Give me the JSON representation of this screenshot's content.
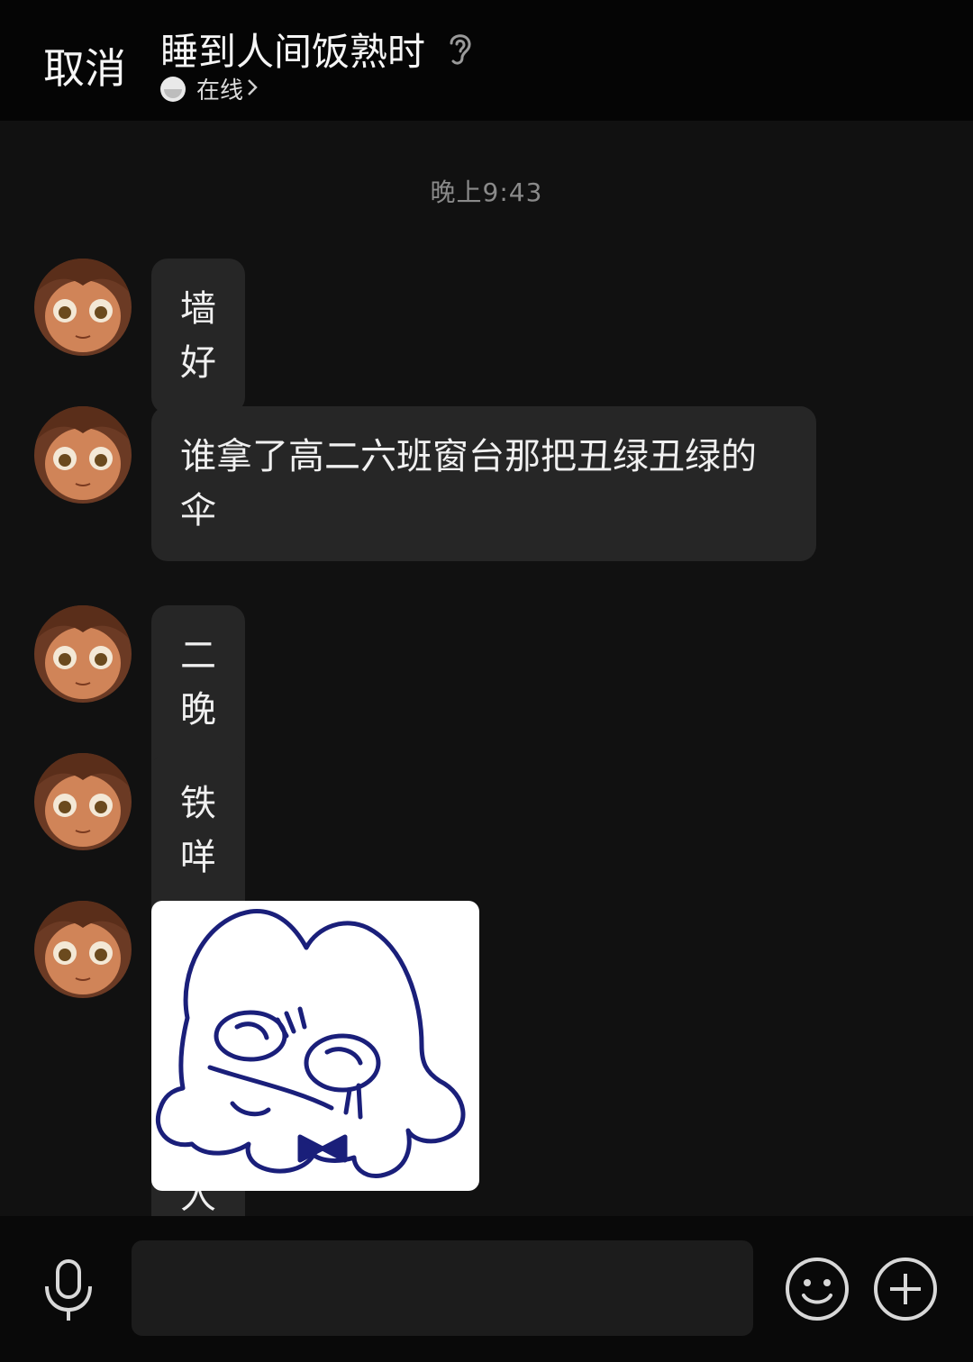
{
  "header": {
    "cancel_label": "取消",
    "title": "睡到人间饭熟时",
    "status": "在线"
  },
  "chat": {
    "timestamp": "晚上9:43",
    "messages": [
      {
        "type": "text",
        "text": "墙好"
      },
      {
        "type": "text",
        "text": "谁拿了高二六班窗台那把丑绿丑绿的伞"
      },
      {
        "type": "text",
        "text": "二晚一放学伞溜的比主人还快"
      },
      {
        "type": "text",
        "text": "铁咩"
      },
      {
        "type": "sticker",
        "icon": "crying-cartoon-sticker"
      }
    ]
  },
  "input_bar": {
    "voice_icon": "microphone-icon",
    "emoji_icon": "smiley-face-icon",
    "more_icon": "plus-circle-icon",
    "input_value": ""
  },
  "colors": {
    "background": "#111111",
    "bubble": "#262626",
    "header": "#050505",
    "sticker_stroke": "#1a1f7a"
  }
}
